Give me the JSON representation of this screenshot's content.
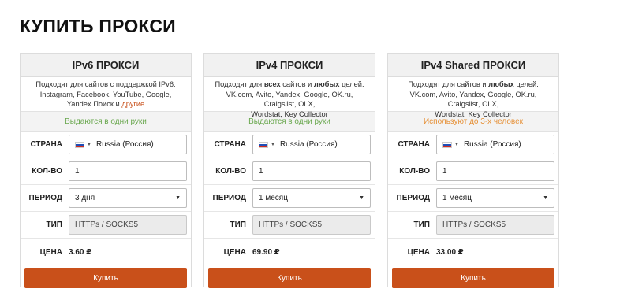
{
  "page": {
    "title": "КУПИТЬ ПРОКСИ"
  },
  "labels": {
    "country": "СТРАНА",
    "quantity": "КОЛ-ВО",
    "period": "ПЕРИОД",
    "type": "ТИП",
    "price": "ЦЕНА"
  },
  "cards": [
    {
      "title": "IPv6 ПРОКСИ",
      "desc_line1": "Подходят для сайтов с поддержкой IPv6.",
      "desc_line2": "Instagram, Facebook, YouTube, Google, Yandex.Поиск и",
      "desc_link": "другие",
      "notice": "Выдаются в одни руки",
      "notice_color": "#6aa84f",
      "country": "Russia (Россия)",
      "quantity": "1",
      "period": "3 дня",
      "type": "HTTPs / SOCKS5",
      "price": "3.60 ₽",
      "buy_label": "Купить"
    },
    {
      "title": "IPv4 ПРОКСИ",
      "desc_a": "Подходят для ",
      "desc_b": "всех",
      "desc_c": " сайтов и ",
      "desc_d": "любых",
      "desc_e": " целей.",
      "desc_line2": "VK.com, Avito, Yandex, Google, OK.ru, Craigslist, OLX,",
      "desc_line3": "Wordstat, Key Collector",
      "notice": "Выдаются в одни руки",
      "notice_color": "#6aa84f",
      "country": "Russia (Россия)",
      "quantity": "1",
      "period": "1 месяц",
      "type": "HTTPs / SOCKS5",
      "price": "69.90 ₽",
      "buy_label": "Купить"
    },
    {
      "title": "IPv4 Shared ПРОКСИ",
      "desc_a": "Подходят для сайтов и ",
      "desc_b": "любых",
      "desc_c": " целей.",
      "desc_line2": "VK.com, Avito, Yandex, Google, OK.ru, Craigslist, OLX,",
      "desc_line3": "Wordstat, Key Collector",
      "notice": "Используют до 3-х человек",
      "notice_color": "#e69138",
      "country": "Russia (Россия)",
      "quantity": "1",
      "period": "1 месяц",
      "type": "HTTPs / SOCKS5",
      "price": "33.00 ₽",
      "buy_label": "Купить"
    }
  ],
  "colors": {
    "accent_button": "#c9501a",
    "notice_green": "#6aa84f",
    "notice_orange": "#e69138"
  },
  "icons": {
    "country_flag": "russia-flag-icon",
    "dropdown": "chevron-down-icon"
  }
}
